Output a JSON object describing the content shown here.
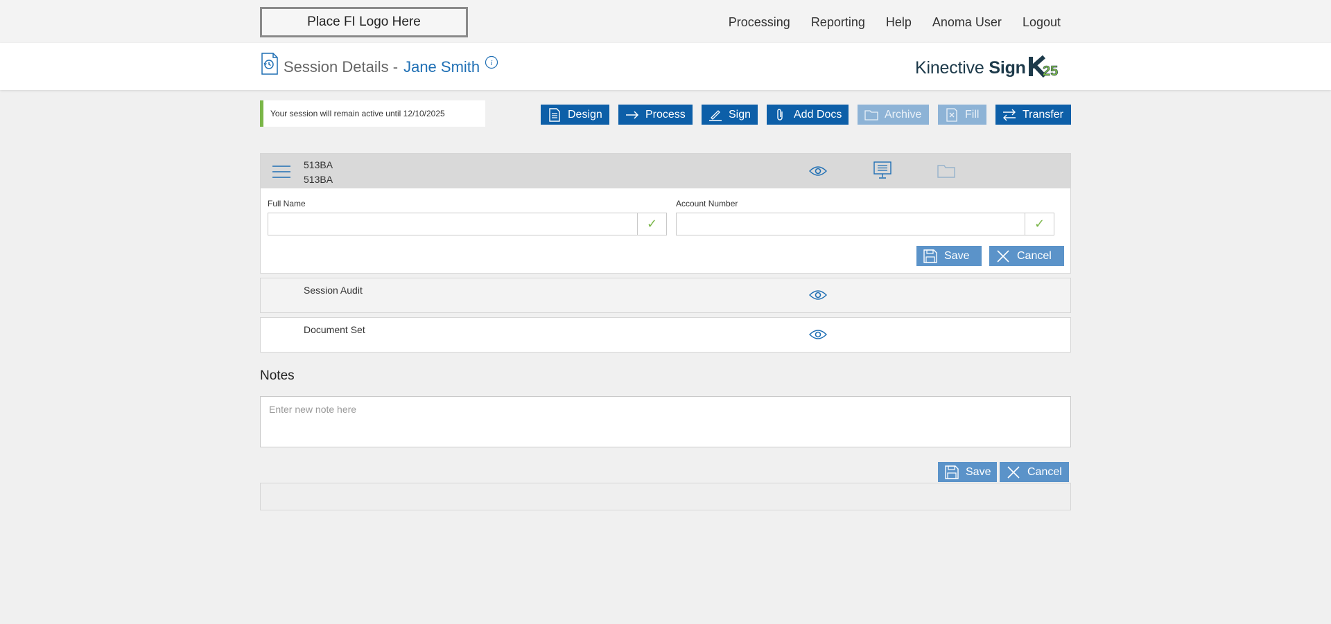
{
  "topbar": {
    "logo_text": "Place FI Logo Here",
    "nav": [
      "Processing",
      "Reporting",
      "Help",
      "Anoma User",
      "Logout"
    ]
  },
  "header": {
    "title": "Session Details -",
    "name": "Jane Smith",
    "brand_light": "Kinective",
    "brand_bold": "Sign"
  },
  "notice": "Your session will remain active until 12/10/2025",
  "actions": {
    "design": "Design",
    "process": "Process",
    "sign": "Sign",
    "add_docs": "Add Docs",
    "archive": "Archive",
    "fill": "Fill",
    "transfer": "Transfer"
  },
  "document": {
    "code_line1": "513BA",
    "code_line2": "513BA",
    "full_name_label": "Full Name",
    "full_name_value": "",
    "account_number_label": "Account Number",
    "account_number_value": "",
    "save": "Save",
    "cancel": "Cancel"
  },
  "rows": {
    "session_audit": "Session Audit",
    "document_set": "Document Set"
  },
  "notes": {
    "title": "Notes",
    "placeholder": "Enter new note here",
    "save": "Save",
    "cancel": "Cancel"
  },
  "colors": {
    "primary": "#0d5fa8",
    "primary_light": "#5b93c9",
    "disabled": "#8db3d6",
    "accent_green": "#7ab648"
  }
}
